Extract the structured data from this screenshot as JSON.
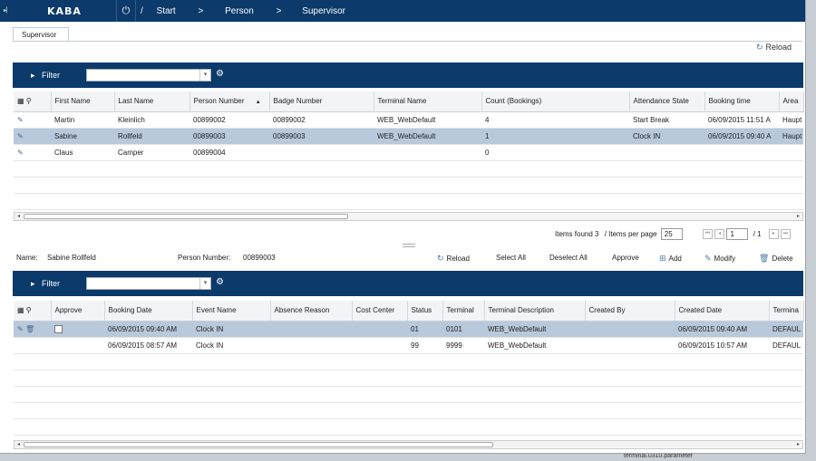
{
  "topbar": {
    "logo": "KABA",
    "crumbs": [
      "/",
      "Start",
      ">",
      "Person",
      ">",
      "Supervisor"
    ]
  },
  "tab": {
    "label": "Supervisor"
  },
  "toolbar": {
    "reload": "Reload"
  },
  "filter": {
    "label": "Filter",
    "value": ""
  },
  "persons": {
    "columns": [
      "First Name",
      "Last Name",
      "Person Number",
      "Badge Number",
      "Terminal Name",
      "Count (Bookings)",
      "Attendance State",
      "Booking time",
      "Area"
    ],
    "rows": [
      [
        "Martin",
        "Kleinlich",
        "00899002",
        "00899002",
        "WEB_WebDefault",
        "4",
        "Start Break",
        "06/09/2015 11:51 A",
        "Haupt"
      ],
      [
        "Sabine",
        "Rollfeld",
        "00899003",
        "00899003",
        "WEB_WebDefault",
        "1",
        "Clock IN",
        "06/09/2015 09:40 A",
        "Haupt"
      ],
      [
        "Claus",
        "Camper",
        "00899004",
        "",
        "",
        "0",
        "",
        "",
        ""
      ]
    ],
    "selected_row": 1
  },
  "pager": {
    "items_found": "Items found 3",
    "per_page_label": "/ Items per page",
    "per_page": "25",
    "page": "1",
    "total": "/ 1"
  },
  "detail": {
    "name_label": "Name:",
    "name": "Sabine Rollfeld",
    "pn_label": "Person Number:",
    "pn": "00899003",
    "actions": {
      "reload": "Reload",
      "select_all": "Select All",
      "deselect_all": "Deselect All",
      "approve": "Approve",
      "add": "Add",
      "modify": "Modify",
      "delete": "Delete"
    }
  },
  "filter2": {
    "label": "Filter",
    "value": ""
  },
  "bookings": {
    "columns": [
      "Approve",
      "Booking Date",
      "Event Name",
      "Absence Reason",
      "Cost Center",
      "Status",
      "Terminal",
      "Terminal Description",
      "Created By",
      "Created Date",
      "Termina"
    ],
    "rows": [
      [
        "",
        "06/09/2015 09:40 AM",
        "Clock IN",
        "",
        "",
        "01",
        "0101",
        "WEB_WebDefault",
        "",
        "06/09/2015 09:40 AM",
        "DEFAUL"
      ],
      [
        "",
        "06/09/2015 08:57 AM",
        "Clock IN",
        "",
        "",
        "99",
        "9999",
        "WEB_WebDefault",
        "",
        "06/09/2015 10:57 AM",
        "DEFAUL"
      ]
    ],
    "selected_row": 0
  },
  "background_text": "terminal.0310.parameter"
}
